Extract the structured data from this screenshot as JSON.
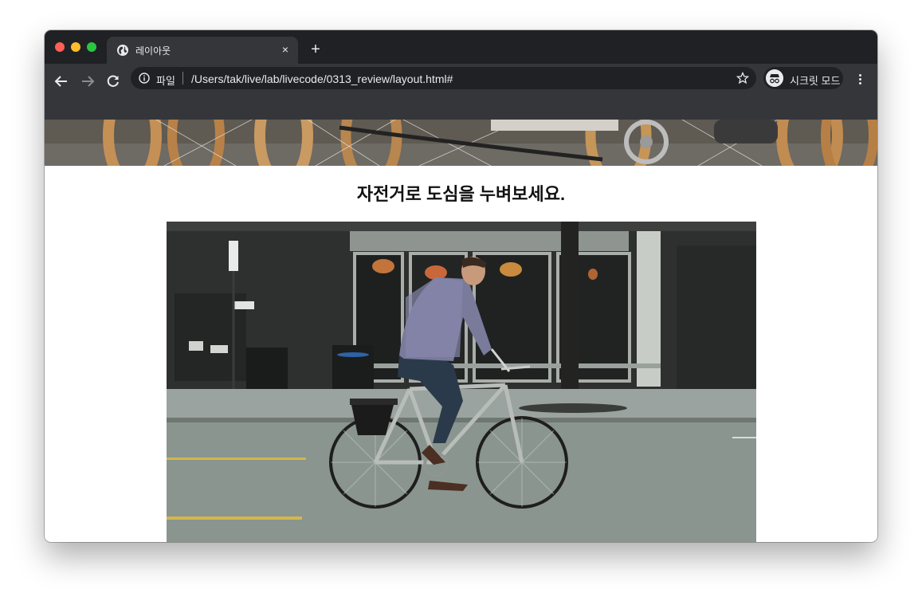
{
  "browser": {
    "tab_title": "레이아웃",
    "tab_close_glyph": "×",
    "new_tab_glyph": "+",
    "address_chip": "파일",
    "url": "/Users/tak/live/lab/livecode/0313_review/layout.html#",
    "incognito_label": "시크릿 모드"
  },
  "page": {
    "headline": "자전거로 도심을 누벼보세요."
  },
  "colors": {
    "tabstrip": "#202124",
    "toolbar": "#35363a",
    "omnibox": "#202124",
    "text_light": "#e8eaed",
    "page_background": "#ffffff",
    "headline": "#111111"
  },
  "icons": {
    "tab_favicon": "globe-icon",
    "back": "arrow-left-icon",
    "forward": "arrow-right-icon",
    "reload": "reload-icon",
    "site_info": "info-icon",
    "bookmark": "star-icon",
    "incognito": "incognito-icon",
    "menu": "more-vert-icon"
  }
}
